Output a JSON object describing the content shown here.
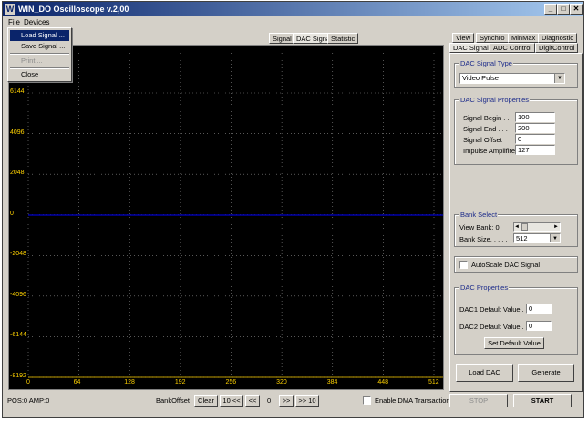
{
  "window": {
    "title": "WIN_DO Oscilloscope v.2,00",
    "icon_glyph": "W",
    "min_glyph": "_",
    "max_glyph": "□",
    "close_glyph": "✕"
  },
  "menu": {
    "items": [
      {
        "label": "File"
      },
      {
        "label": "Devices"
      }
    ],
    "file_dropdown": [
      {
        "label": "Load Signal ..."
      },
      {
        "label": "Save Signal ..."
      },
      {
        "label": "Print ..."
      },
      {
        "label": "Close"
      }
    ]
  },
  "plot_tabs": [
    {
      "label": "Signal"
    },
    {
      "label": "DAC Signal"
    },
    {
      "label": "Statistic"
    }
  ],
  "scope": {
    "y_ticks": [
      "6144",
      "4096",
      "2048",
      "0",
      "-2048",
      "-4096",
      "-6144",
      "-8192"
    ],
    "x_ticks": [
      "0",
      "64",
      "128",
      "192",
      "256",
      "320",
      "384",
      "448",
      "512"
    ]
  },
  "status": {
    "pos_amp": "POS:0  AMP:0",
    "bank_offset_label": "BankOffset",
    "clear_label": "Clear",
    "nav_back10": "10 <<",
    "nav_back1": "<<",
    "offset_value": "0",
    "nav_fwd1": ">>",
    "nav_fwd10": ">> 10",
    "dma_label": "Enable DMA Transaction",
    "stop_label": "STOP",
    "start_label": "START"
  },
  "right_tabs_row1": [
    {
      "label": "View"
    },
    {
      "label": "Synchro"
    },
    {
      "label": "MinMax"
    },
    {
      "label": "Diagnostic"
    }
  ],
  "right_tabs_row2": [
    {
      "label": "DAC Signal"
    },
    {
      "label": "ADC Control"
    },
    {
      "label": "DigitControl"
    }
  ],
  "dac_type": {
    "title": "DAC Signal Type",
    "selected": "Video Pulse"
  },
  "dac_props": {
    "title": "DAC Signal Properties",
    "begin_label": "Signal Begin . .",
    "begin_value": "100",
    "end_label": "Signal End . . .",
    "end_value": "200",
    "offset_label": "Signal Offset",
    "offset_value": "0",
    "amp_label": "Impulse Amplifire",
    "amp_value": "127"
  },
  "bank": {
    "title": "Bank Select",
    "view_label": "View Bank: 0",
    "size_label": "Bank Size. . . . .",
    "size_value": "512",
    "left_arrow": "◄",
    "right_arrow": "►"
  },
  "autoscale": {
    "label": "AutoScale DAC Signal"
  },
  "dac_defaults": {
    "title": "DAC Properties",
    "dac1_label": "DAC1 Default Value . .",
    "dac1_value": "0",
    "dac2_label": "DAC2 Default Value . .",
    "dac2_value": "0",
    "set_label": "Set Default Value"
  },
  "actions": {
    "load_label": "Load DAC",
    "generate_label": "Generate"
  },
  "colors": {
    "plot_bg": "#000000",
    "grid": "#8c8c8c",
    "signal": "#0000ff",
    "tick_text": "#ffd200"
  }
}
